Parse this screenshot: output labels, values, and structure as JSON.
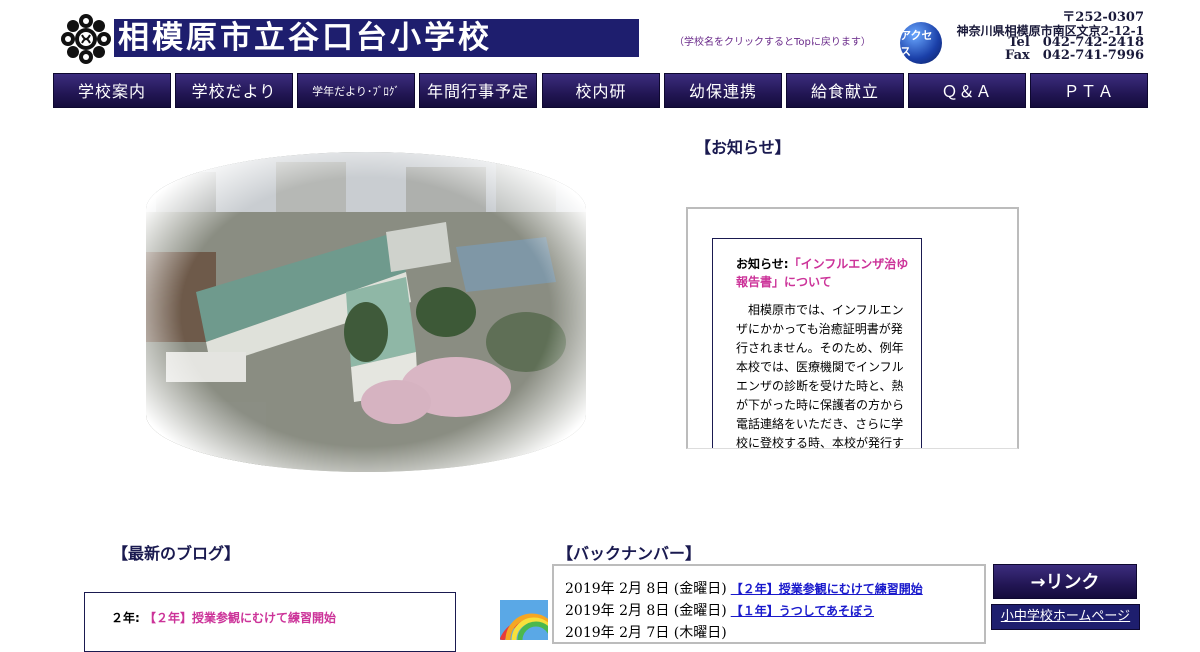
{
  "header": {
    "school_name": "相模原市立谷口台小学校",
    "click_hint": "（学校名をクリックするとTopに戻ります）",
    "access_label": "アクセス",
    "postal": "〒252-0307",
    "address": "神奈川県相模原市南区文京2-12-1",
    "tel": "Tel　042-742-2418",
    "fax": "Fax　042-741-7996"
  },
  "nav": {
    "items": [
      {
        "label": "学校案内"
      },
      {
        "label": "学校だより"
      },
      {
        "label": "学年だより･ﾌﾞﾛｸﾞ"
      },
      {
        "label": "年間行事予定"
      },
      {
        "label": "校内研"
      },
      {
        "label": "幼保連携"
      },
      {
        "label": "給食献立"
      },
      {
        "label": "Ｑ＆Ａ"
      },
      {
        "label": "ＰＴＡ"
      }
    ]
  },
  "news": {
    "heading": "【お知らせ】",
    "label": "お知らせ:",
    "title": "「インフルエンザ治ゆ報告書」について",
    "body": "相模原市では、インフルエンザにかかっても治癒証明書が発行されません。そのため、例年本校では、医療機関でインフルエンザの診断を受けた時と、熱が下がった時に保護者の方から電話連絡をいただき、さらに学校に登校する時、本校が発行する「インフルエンザ治ゆ報告書」"
  },
  "blog": {
    "heading": "【最新のブログ】",
    "grade": "２年:",
    "title": "【２年】授業参観にむけて練習開始"
  },
  "back_numbers": {
    "heading": "【バックナンバー】",
    "items": [
      {
        "date": "2019年 2月 8日 (金曜日)",
        "title": "【２年】授業参観にむけて練習開始"
      },
      {
        "date": "2019年 2月 8日 (金曜日)",
        "title": "【１年】うつしてあそぼう"
      },
      {
        "date": "2019年 2月 7日 (木曜日)",
        "title": ""
      }
    ]
  },
  "links": {
    "button": "→リンク",
    "first_item": "小中学校ホームページ"
  }
}
